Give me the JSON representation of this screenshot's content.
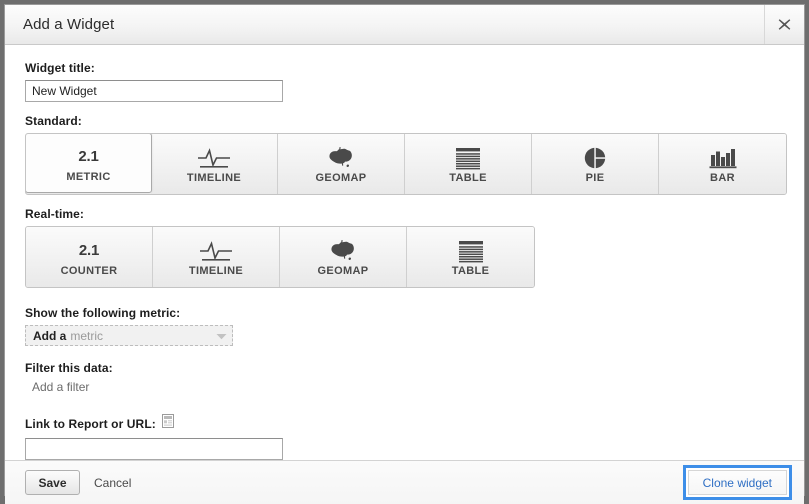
{
  "dialog": {
    "title": "Add a Widget",
    "close_icon": "close-icon"
  },
  "widget_title": {
    "label": "Widget title:",
    "value": "New Widget",
    "placeholder": ""
  },
  "standard": {
    "label": "Standard:",
    "tiles": [
      {
        "label": "METRIC",
        "icon": "number-2-1-icon",
        "icon_text": "2.1",
        "selected": true
      },
      {
        "label": "TIMELINE",
        "icon": "line-chart-icon",
        "icon_text": "",
        "selected": false
      },
      {
        "label": "GEOMAP",
        "icon": "australia-map-icon",
        "icon_text": "",
        "selected": false
      },
      {
        "label": "TABLE",
        "icon": "table-rows-icon",
        "icon_text": "",
        "selected": false
      },
      {
        "label": "PIE",
        "icon": "pie-chart-icon",
        "icon_text": "",
        "selected": false
      },
      {
        "label": "BAR",
        "icon": "bar-chart-icon",
        "icon_text": "",
        "selected": false
      }
    ]
  },
  "realtime": {
    "label": "Real-time:",
    "tiles": [
      {
        "label": "COUNTER",
        "icon": "number-2-1-icon",
        "icon_text": "2.1",
        "selected": false
      },
      {
        "label": "TIMELINE",
        "icon": "line-chart-icon",
        "icon_text": "",
        "selected": false
      },
      {
        "label": "GEOMAP",
        "icon": "australia-map-icon",
        "icon_text": "",
        "selected": false
      },
      {
        "label": "TABLE",
        "icon": "table-rows-icon",
        "icon_text": "",
        "selected": false
      }
    ]
  },
  "metric": {
    "label": "Show the following metric:",
    "dropdown_strong": "Add a",
    "dropdown_grey": "metric",
    "arrow_icon": "chevron-down-icon"
  },
  "filter": {
    "label": "Filter this data:",
    "add_filter": "Add a filter"
  },
  "link": {
    "label": "Link to Report or URL:",
    "report_icon": "report-document-icon",
    "value": "",
    "placeholder": ""
  },
  "footer": {
    "save_label": "Save",
    "cancel_label": "Cancel",
    "clone_label": "Clone widget"
  },
  "colors": {
    "focus_blue": "#3d8ee8",
    "link_blue": "#2f6fc4",
    "window_backdrop": "#6e6e6e",
    "icon_dark": "#4a4a4a"
  }
}
